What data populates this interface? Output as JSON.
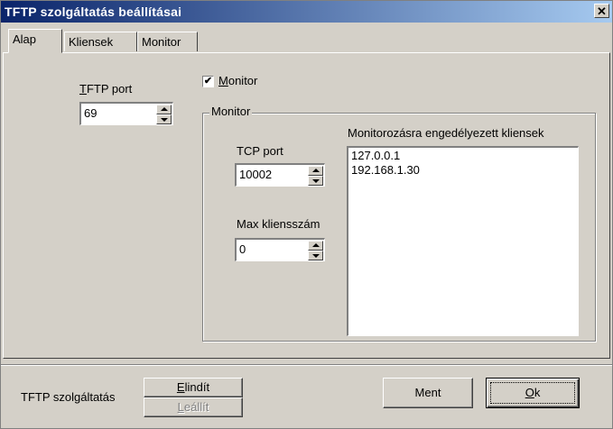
{
  "window": {
    "title": "TFTP szolgáltatás beállításai",
    "close_glyph": "✕"
  },
  "tabs": [
    {
      "label": "Alap",
      "active": true
    },
    {
      "label": "Kliensek",
      "active": false
    },
    {
      "label": "Monitor",
      "active": false
    }
  ],
  "tftp_port": {
    "label_mnemonic": "T",
    "label_rest": "FTP port",
    "value": "69"
  },
  "monitor_checkbox": {
    "checked": true,
    "check_glyph": "✔",
    "label_mnemonic": "M",
    "label_rest": "onitor"
  },
  "monitor_group": {
    "title": "Monitor",
    "tcp_port": {
      "label": "TCP port",
      "value": "10002"
    },
    "max_clients": {
      "label": "Max kliensszám",
      "value": "0"
    },
    "allowed_clients": {
      "label": "Monitorozásra engedélyezett kliensek",
      "items": [
        "127.0.0.1",
        "192.168.1.30"
      ]
    }
  },
  "footer": {
    "service_label": "TFTP szolgáltatás",
    "start_button": {
      "mnemonic": "E",
      "rest": "lindít",
      "enabled": true
    },
    "stop_button": {
      "mnemonic": "L",
      "rest": "eállít",
      "enabled": false
    },
    "save_button": {
      "label": "Ment"
    },
    "ok_button": {
      "mnemonic": "O",
      "rest": "k"
    }
  },
  "colors": {
    "title_gradient_start": "#0a246a",
    "title_gradient_end": "#a6caf0",
    "face": "#d4d0c8"
  }
}
